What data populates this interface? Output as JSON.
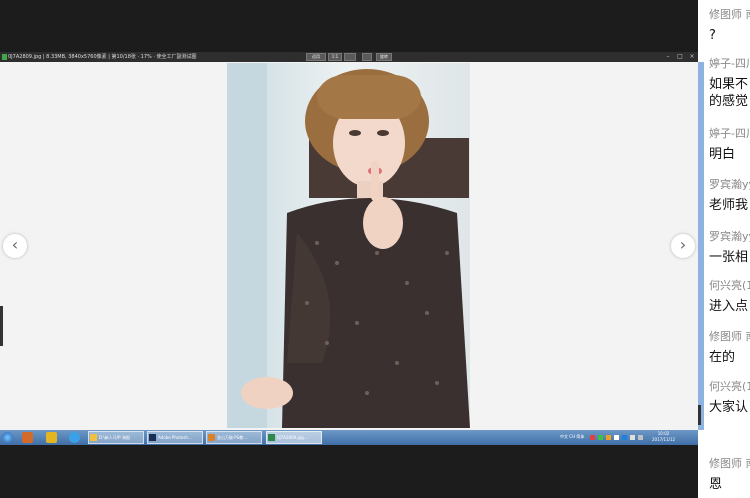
{
  "viewer": {
    "title": "0J7A2809.jpg | 8.33MB, 3840x5760像素 | 第10/18张 · 17% · 使全工厂副测试图",
    "toolbar": [
      "适用",
      "1:1",
      "旋转"
    ],
    "prev": "‹",
    "next": "›"
  },
  "taskbar": {
    "tasks": [
      "D:\\新人马甲 海报",
      "Adobe Photosh...",
      "金山万能·PS教...",
      "0J7A2809.jpg..."
    ],
    "tray_text": "中文 CH 简体",
    "time": "10:02",
    "date": "2017/11/12"
  },
  "chat": {
    "messages": [
      {
        "who": "修图师 南",
        "text": [
          "?"
        ]
      },
      {
        "who": "婷子-四川",
        "text": [
          "如果不",
          "的感觉"
        ]
      },
      {
        "who": "婷子-四川",
        "text": [
          "明白"
        ]
      },
      {
        "who": "罗宾瀚yy",
        "text": [
          "老师我"
        ]
      },
      {
        "who": "罗宾瀚yy",
        "text": [
          "一张相"
        ]
      },
      {
        "who": "何兴亮(1",
        "text": [
          "进入点"
        ]
      },
      {
        "who": "修图师 南",
        "text": [
          "在的"
        ]
      },
      {
        "who": "何兴亮(1",
        "text": [
          "大家认"
        ]
      },
      {
        "who": "修图师 南",
        "text": [
          "恩"
        ]
      }
    ]
  },
  "colors": {
    "taskbar": "#4a7ab3",
    "chat_edge": "#8fb3df"
  }
}
